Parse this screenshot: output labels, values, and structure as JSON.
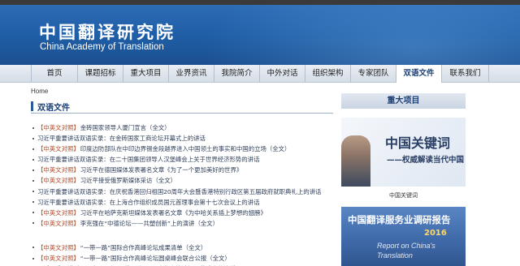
{
  "header": {
    "title_cn": "中国翻译研究院",
    "title_en": "China Academy of Translation"
  },
  "nav": {
    "items": [
      {
        "label": "首页",
        "width": 58
      },
      {
        "label": "课题招标",
        "width": 56
      },
      {
        "label": "重大项目",
        "width": 56
      },
      {
        "label": "业界资讯",
        "width": 56
      },
      {
        "label": "我院简介",
        "width": 56
      },
      {
        "label": "中外对话",
        "width": 56
      },
      {
        "label": "组织架构",
        "width": 56
      },
      {
        "label": "专家团队",
        "width": 56
      },
      {
        "label": "双语文件",
        "width": 56,
        "active": true
      },
      {
        "label": "联系我们",
        "width": 58
      }
    ]
  },
  "breadcrumb": "Home",
  "section_title": "双语文件",
  "articles": [
    {
      "tag": "【中英文对照】",
      "text": "金砖国家领导人厦门宣言（全文）"
    },
    {
      "tag": "",
      "text": "习近平重要讲话双语实录：在金砖国家工商论坛开幕式上的讲话"
    },
    {
      "tag": "【中英文对照】",
      "text": "印度边防部队在中印边界锡金段越界进入中国领土的事实和中国的立场（全文）"
    },
    {
      "tag": "",
      "text": "习近平重要讲话双语实录：在二十国集团领导人汉堡峰会上关于世界经济形势的讲话"
    },
    {
      "tag": "【中英文对照】",
      "text": "习近平在德国媒体发表署名文章《为了一个更加美好的世界》"
    },
    {
      "tag": "【中英文对照】",
      "text": "习近平接受俄罗斯媒体采访（全文）"
    },
    {
      "tag": "",
      "text": "习近平重要讲话双语实录：在庆祝香港回归祖国20周年大会暨香港特别行政区第五届政府就职典礼上的讲话"
    },
    {
      "tag": "",
      "text": "习近平重要讲话双语实录：在上海合作组织成员国元首理事会第十七次会议上的讲话"
    },
    {
      "tag": "【中英文对照】",
      "text": "习近平在哈萨克斯坦媒体发表署名文章《为中哈关系插上梦想的翅膀》"
    },
    {
      "tag": "【中英文对照】",
      "text": "李克强在“中德论坛——共塑创新”上的演讲（全文）"
    },
    {
      "tag": "【中英文对照】",
      "text": "“一带一路”国际合作高峰论坛成果清单（全文）",
      "gap_before": true
    },
    {
      "tag": "【中英文对照】",
      "text": "“一带一路”国际合作高峰论坛圆桌峰会联合公报（全文）"
    },
    {
      "tag": "",
      "text": "习近平重要讲话双语实录：在“一带一路”国际合作高峰论坛开幕式上的演讲"
    }
  ],
  "sidebar": {
    "heading": "重大项目",
    "banner1": {
      "title": "中国关键词",
      "subtitle": "——权威解读当代中国",
      "caption": "中国关键词"
    },
    "banner2": {
      "title": "中国翻译服务业调研报告",
      "year": "2016",
      "en_line1": "Report on China's",
      "en_line2": "Translation"
    }
  }
}
